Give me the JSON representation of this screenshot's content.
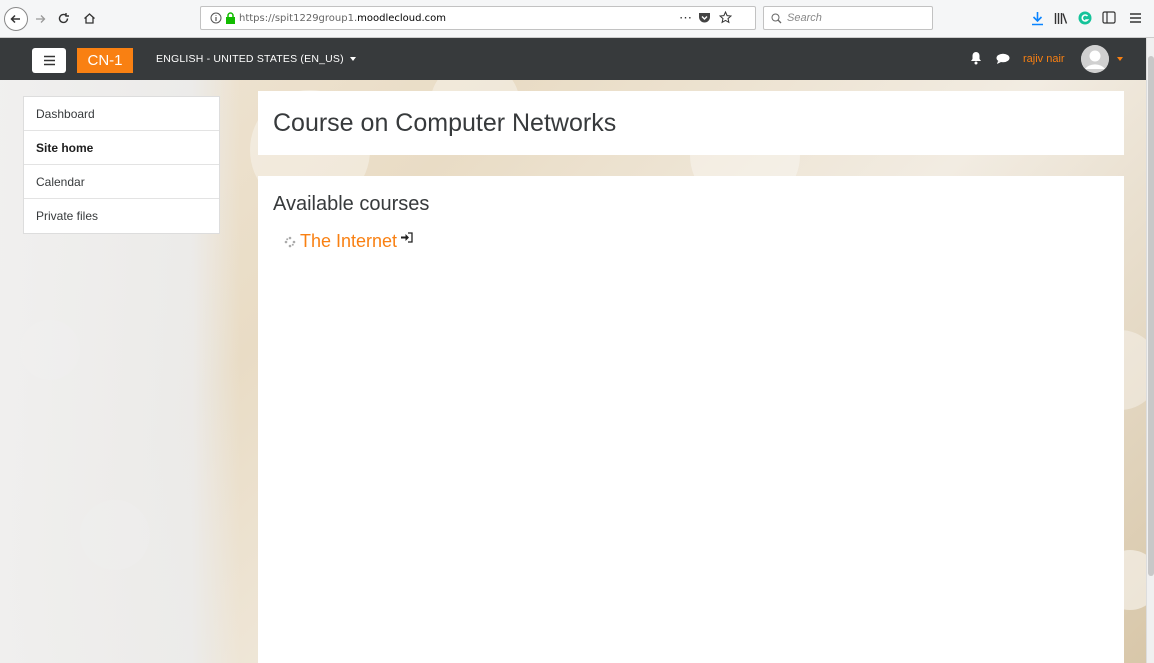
{
  "browser": {
    "url_host": "https://spit1229group1.",
    "url_domain": "moodlecloud.com",
    "search_placeholder": "Search",
    "more_glyph": "⋯"
  },
  "navbar": {
    "brand": "CN-1",
    "language": "ENGLISH - UNITED STATES (EN_US)",
    "username": "rajiv nair"
  },
  "sidebar": {
    "items": [
      {
        "label": "Dashboard"
      },
      {
        "label": "Site home",
        "active": true
      },
      {
        "label": "Calendar"
      },
      {
        "label": "Private files"
      }
    ]
  },
  "header": {
    "title": "Course on Computer Networks"
  },
  "main": {
    "section_title": "Available courses",
    "courses": [
      {
        "name": "The Internet"
      }
    ]
  },
  "colors": {
    "accent": "#f98012",
    "navbar": "#373a3c"
  }
}
